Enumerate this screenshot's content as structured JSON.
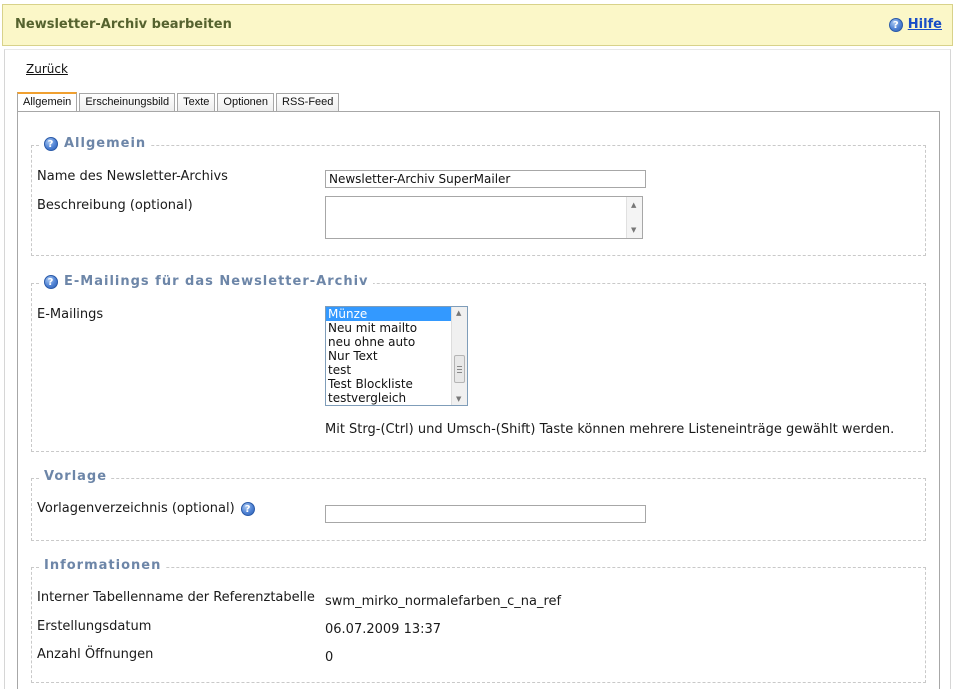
{
  "header": {
    "title": "Newsletter-Archiv bearbeiten",
    "help_label": "Hilfe"
  },
  "nav": {
    "back_label": "Zurück"
  },
  "tabs": [
    {
      "label": "Allgemein",
      "active": true
    },
    {
      "label": "Erscheinungsbild",
      "active": false
    },
    {
      "label": "Texte",
      "active": false
    },
    {
      "label": "Optionen",
      "active": false
    },
    {
      "label": "RSS-Feed",
      "active": false
    }
  ],
  "sections": {
    "allgemein": {
      "legend": "Allgemein",
      "name_label": "Name des Newsletter-Archivs",
      "name_value": "Newsletter-Archiv SuperMailer",
      "description_label": "Beschreibung (optional)",
      "description_value": ""
    },
    "emailings": {
      "legend": "E-Mailings für das Newsletter-Archiv",
      "label": "E-Mailings",
      "options": [
        {
          "label": "Münze",
          "selected": true
        },
        {
          "label": "Neu mit mailto",
          "selected": false
        },
        {
          "label": "neu ohne auto",
          "selected": false
        },
        {
          "label": "Nur Text",
          "selected": false
        },
        {
          "label": "test",
          "selected": false
        },
        {
          "label": "Test Blockliste",
          "selected": false
        },
        {
          "label": "testvergleich",
          "selected": false
        }
      ],
      "hint": "Mit Strg-(Ctrl) und Umsch-(Shift) Taste können mehrere Listeneinträge gewählt werden."
    },
    "vorlage": {
      "legend": "Vorlage",
      "dir_label": "Vorlagenverzeichnis (optional)",
      "dir_value": ""
    },
    "informationen": {
      "legend": "Informationen",
      "table_label": "Interner Tabellenname der Referenztabelle",
      "table_value": "swm_mirko_normalefarben_c_na_ref",
      "created_label": "Erstellungsdatum",
      "created_value": "06.07.2009 13:37",
      "opens_label": "Anzahl Öffnungen",
      "opens_value": "0"
    }
  }
}
